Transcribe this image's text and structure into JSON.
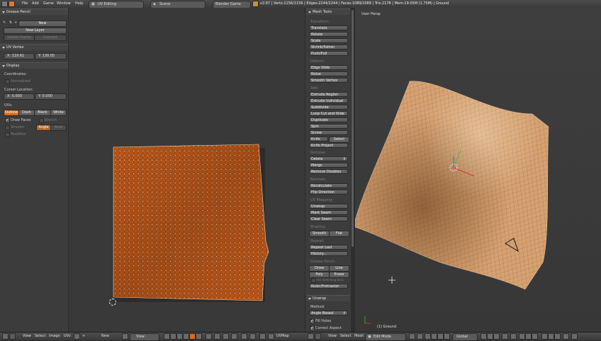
{
  "topbar": {
    "menus": [
      "File",
      "Add",
      "Game",
      "Window",
      "Help"
    ],
    "layout": "UV Editing",
    "scene": "Scene",
    "engine": "Blender Game",
    "stats": "v2.67 | Verts:1156/1156 | Edges:2244/2244 | Faces:1089/1089 | Tris:2178 | Mem:19.05M (1.75M) | Ground"
  },
  "left_panel": {
    "grease_pencil_title": "Grease Pencil",
    "new_label": "New",
    "new_layer_label": "New Layer",
    "delete_frame_label": "Delete Frame",
    "convert_label": "Convert",
    "uv_vertex_title": "UV Vertex",
    "uv_x": "X: 119.61",
    "uv_y": "Y: 130.05",
    "display_title": "Display",
    "coordinates_label": "Coordinates:",
    "normalized_label": "Normalized",
    "cursor_location_label": "Cursor Location:",
    "cursor_x": "X: 0.000",
    "cursor_y": "Y: 0.000",
    "uvs_label": "UVs:",
    "uv_styles": [
      "Outline",
      "Dash",
      "Black",
      "White"
    ],
    "draw_faces_label": "Draw Faces",
    "stretch_label": "Stretch",
    "smooth_label": "Smooth",
    "angle_label": "Angle",
    "area_label": "Area",
    "modified_label": "Modified"
  },
  "uv_header": {
    "items": [
      "View",
      "Select",
      "Image",
      "UVs"
    ],
    "new_label": "New",
    "view_label": "View",
    "uvmap_label": "UVMap"
  },
  "mesh_tools": {
    "title": "Mesh Tools",
    "sections": [
      {
        "label": "Transform:",
        "buttons": [
          "Translate",
          "Rotate",
          "Scale",
          "Shrink/Fatten",
          "Push/Pull"
        ]
      },
      {
        "label": "Deform:",
        "buttons": [
          "Edge Slide",
          "Noise",
          "Smooth Vertex"
        ]
      },
      {
        "label": "Add:",
        "buttons": [
          "Extrude Region",
          "Extrude Individual",
          "Subdivide",
          "Loop Cut and Slide",
          "Duplicate",
          "Spin",
          "Screw"
        ]
      }
    ],
    "knife_label": "Knife",
    "select_label": "Select",
    "knife_project_label": "Knife Project",
    "remove_label": "Remove:",
    "delete_label": "Delete",
    "merge_label": "Merge",
    "remove_doubles_label": "Remove Doubles",
    "normals_label": "Normals:",
    "recalculate_label": "Recalculate",
    "flip_direction_label": "Flip Direction",
    "uv_mapping_label": "UV Mapping:",
    "unwrap_label": "Unwrap",
    "mark_seam_label": "Mark Seam",
    "clear_seam_label": "Clear Seam",
    "shading_label": "Shading:",
    "smooth_label": "Smooth",
    "flat_label": "Flat",
    "repeat_label": "Repeat:",
    "repeat_last_label": "Repeat Last",
    "history_label": "History...",
    "grease_pencil_label": "Grease Pencil:",
    "draw_label": "Draw",
    "line_label": "Line",
    "poly_label": "Poly",
    "erase_label": "Erase",
    "use_sketching_label": "Use Sketching Sess",
    "ruler_label": "Ruler/Protractor",
    "unwrap_title": "Unwrap",
    "method_label": "Method:",
    "method_value": "Angle Based",
    "fill_holes_label": "Fill Holes",
    "correct_aspect_label": "Correct Aspect"
  },
  "viewport": {
    "view_name": "User Persp",
    "object_label": "(1) Ground",
    "header_items": [
      "View",
      "Select",
      "Mesh"
    ],
    "mode_label": "Edit Mode",
    "orientation_label": "Global"
  },
  "colors": {
    "accent": "#d86a1c",
    "uv_fill": "#b8561a",
    "mesh_tan": "#d6a272"
  }
}
